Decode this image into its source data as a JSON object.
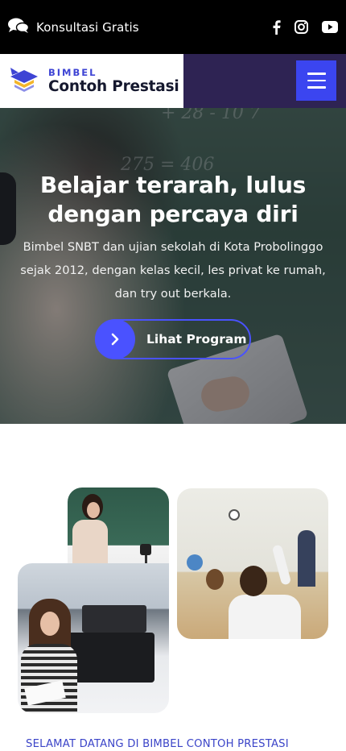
{
  "topbar": {
    "consult_label": "Konsultasi Gratis",
    "consult_icon": "chat-bubbles-icon",
    "socials": [
      "facebook-icon",
      "instagram-icon",
      "youtube-icon"
    ]
  },
  "header": {
    "logo_small": "BIMBEL",
    "logo_big": "Contoh Prestasi",
    "menu_icon": "hamburger-menu-icon",
    "colors": {
      "header_bg": "#2e2353",
      "accent": "#3b45f0"
    }
  },
  "hero": {
    "title": "Belajar terarah, lulus dengan percaya diri",
    "description": "Bimbel SNBT dan ujian sekolah di Kota Probolinggo sejak 2012, dengan kelas kecil, les privat ke rumah, dan try out berkala.",
    "cta_label": "Lihat Program",
    "cta_icon": "chevron-right-icon"
  },
  "welcome": {
    "text": "SELAMAT DATANG DI BIMBEL CONTOH PRESTASI"
  }
}
